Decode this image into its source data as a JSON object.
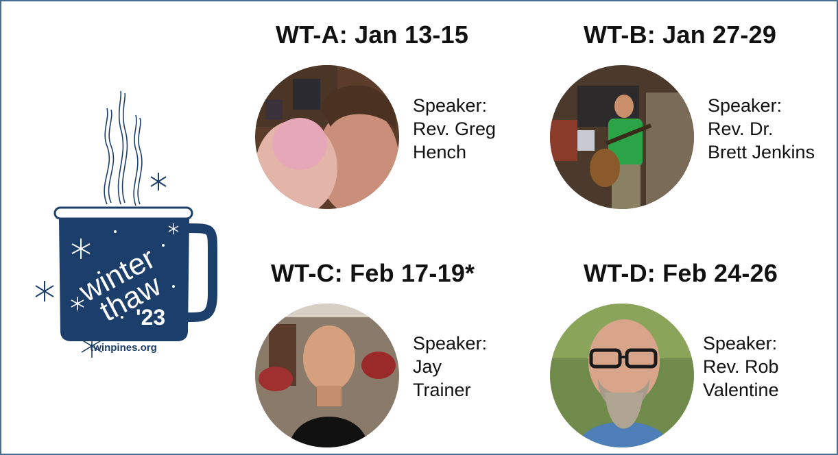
{
  "colors": {
    "border": "#4a6d92",
    "mug": "#1c3e6a",
    "text": "#111111"
  },
  "logo": {
    "line1": "winter",
    "line2": "thaw",
    "year": "'23",
    "website": "twinpines.org"
  },
  "events": [
    {
      "title": "WT-A: Jan 13-15",
      "speaker_label": "Speaker:",
      "speaker_line1": "Rev. Greg",
      "speaker_line2": "Hench"
    },
    {
      "title": "WT-B: Jan 27-29",
      "speaker_label": "Speaker:",
      "speaker_line1": "Rev. Dr.",
      "speaker_line2": "Brett Jenkins"
    },
    {
      "title": "WT-C: Feb 17-19*",
      "speaker_label": "Speaker:",
      "speaker_line1": "Jay",
      "speaker_line2": "Trainer"
    },
    {
      "title": "WT-D: Feb 24-26",
      "speaker_label": "Speaker:",
      "speaker_line1": "Rev. Rob",
      "speaker_line2": "Valentine"
    }
  ]
}
